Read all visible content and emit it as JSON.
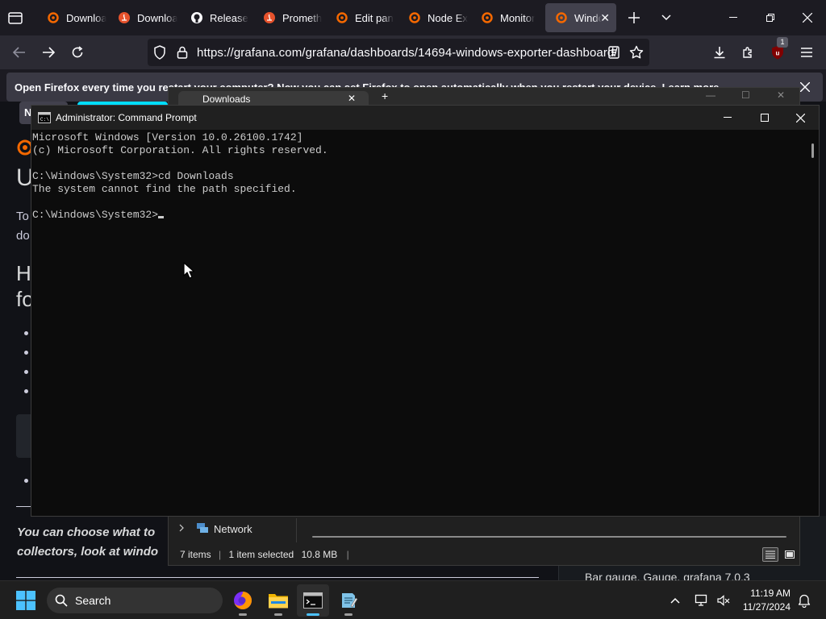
{
  "browser": {
    "tabs": [
      {
        "label": "Downloa",
        "favicon": "grafana-icon"
      },
      {
        "label": "Downloa",
        "favicon": "prometheus-icon"
      },
      {
        "label": "Release",
        "favicon": "github-icon"
      },
      {
        "label": "Prometh",
        "favicon": "prometheus-icon"
      },
      {
        "label": "Edit pan",
        "favicon": "grafana-icon"
      },
      {
        "label": "Node Ex",
        "favicon": "grafana-icon"
      },
      {
        "label": "Monitor",
        "favicon": "grafana-icon"
      },
      {
        "label": "Windo",
        "favicon": "grafana-icon",
        "active": true
      }
    ],
    "url": "https://grafana.com/grafana/dashboards/14694-windows-exporter-dashboard/",
    "extension_badge": "1",
    "notification": "Open Firefox every time you restart your computer? Now you can set Firefox to open automatically when you restart your device.  Learn more"
  },
  "page": {
    "fragments": [
      "U",
      "To",
      "do",
      "H",
      "fo",
      "N"
    ],
    "italic_line1": "You can choose what to",
    "italic_line2": "collectors, look at windo",
    "right_panel_text": "Bar gauge, Gauge, grafana 7.0.3"
  },
  "explorer": {
    "title": "Downloads",
    "nav_item": "Network",
    "status_items": "7 items",
    "status_selected": "1 item selected",
    "status_size": "10.8 MB"
  },
  "cmd": {
    "title": "Administrator: Command Prompt",
    "lines": [
      "Microsoft Windows [Version 10.0.26100.1742]",
      "(c) Microsoft Corporation. All rights reserved.",
      "",
      "C:\\Windows\\System32>cd Downloads",
      "The system cannot find the path specified.",
      ""
    ],
    "prompt": "C:\\Windows\\System32>"
  },
  "taskbar": {
    "search_label": "Search",
    "time": "11:19 AM",
    "date": "11/27/2024"
  },
  "colors": {
    "firefox_bg": "#1c1b22",
    "firefox_toolbar": "#2b2a33",
    "grafana_orange": "#f46800",
    "cmd_bg": "#0c0c0c",
    "cmd_text": "#cccccc",
    "taskbar_bg": "#1f1f1f",
    "win_accent": "#4cc2ff",
    "extension_badge_red": "#e22850"
  }
}
